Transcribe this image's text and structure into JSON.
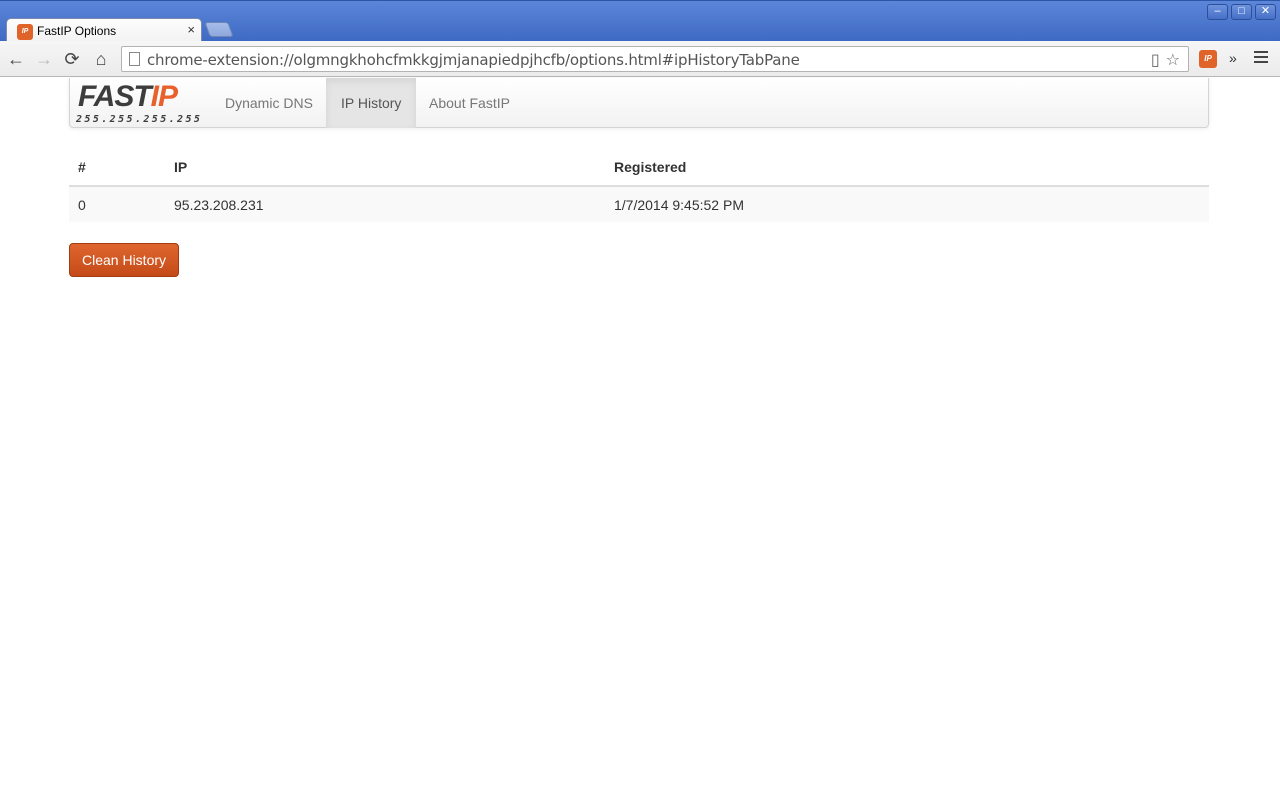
{
  "browser": {
    "tab_title": "FastIP Options",
    "tab_close": "×",
    "favicon_text": "IP",
    "url": "chrome-extension://olgmngkhohcfmkkgjmjanapiedpjhcfb/options.html#ipHistoryTabPane",
    "window_buttons": [
      "–",
      "□",
      "✕"
    ],
    "nav_icons": {
      "back": "←",
      "forward": "→",
      "reload": "⟳",
      "home": "⌂"
    },
    "extension_icon_text": "IP",
    "overflow_chevron": "»"
  },
  "navbar": {
    "brand_main": "FAST",
    "brand_accent": "IP",
    "brand_sub": "255.255.255.255",
    "links": [
      {
        "label": "Dynamic DNS",
        "active": false
      },
      {
        "label": "IP History",
        "active": true
      },
      {
        "label": "About FastIP",
        "active": false
      }
    ]
  },
  "history_table": {
    "headers": [
      "#",
      "IP",
      "Registered"
    ],
    "rows": [
      {
        "index": "0",
        "ip": "95.23.208.231",
        "registered": "1/7/2014 9:45:52 PM"
      }
    ]
  },
  "actions": {
    "clean_history_label": "Clean History"
  },
  "colors": {
    "accent": "#e0642a",
    "brand_dark": "#3d3d3d"
  }
}
